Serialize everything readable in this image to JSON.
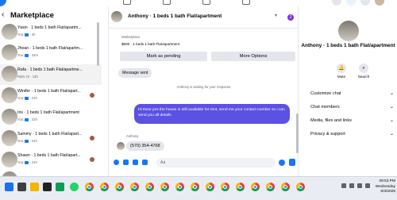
{
  "app": {
    "name": "Facebook Messenger Marketplace"
  },
  "left": {
    "title": "Marketplace",
    "conversations": [
      {
        "name": "Yasin · 1 beds 1 bath Flat/apartm...",
        "sub": "You:",
        "time": "· 4h"
      },
      {
        "name": "Jhoan · 1 beds 1 bath Flat/apartm...",
        "sub": "You:",
        "time": "· 24m"
      },
      {
        "name": "Rafa · 1 beds 1 bath Flat/apartme...",
        "sub": "Rafa: Hi · 14h"
      },
      {
        "name": "Winifer · 1 beds 1 bath Flat/apart...",
        "sub": "You:",
        "time": "· 21h"
      },
      {
        "name": "Iris · 1 beds 1 bath Flat/apartment",
        "sub": "You:",
        "time": "· 21h"
      },
      {
        "name": "Sammy · 1 beds 1 bath Flat/apart...",
        "sub": "You:",
        "time": "· 21h"
      },
      {
        "name": "Shawn · 1 beds 1 bath Flat/apart...",
        "sub": "You:",
        "time": "· 21h"
      },
      {
        "name": "",
        "sub": "",
        "time": ""
      }
    ]
  },
  "chat": {
    "title": "Anthony · 1 beds 1 bath Flat/apartment",
    "badge": "2",
    "listing_label": "Marketplace",
    "listing_price": "$600 · 1 beds 1 bath Flat/apartment",
    "mark_pending": "Mark as pending",
    "more_options": "More Options",
    "message_sent": "Message sent",
    "waiting": "Anthony is waiting for your response.",
    "outgoing": "Hi Dear yes the house is still available for rent, send me your contact number so i can send you all details",
    "incoming_name": "Anthony",
    "incoming": "(570) 354-4768",
    "composer_placeholder": "Aa"
  },
  "right": {
    "name": "Anthony · 1 beds 1 bath Flat/apartment",
    "mute": "Mute",
    "search": "Search",
    "rows": [
      "Customize chat",
      "Chat members",
      "Media, files and links",
      "Privacy & support"
    ]
  },
  "taskbar": {
    "time": "09:53 PM",
    "day": "Wednesday",
    "date": "6/3/2026"
  }
}
